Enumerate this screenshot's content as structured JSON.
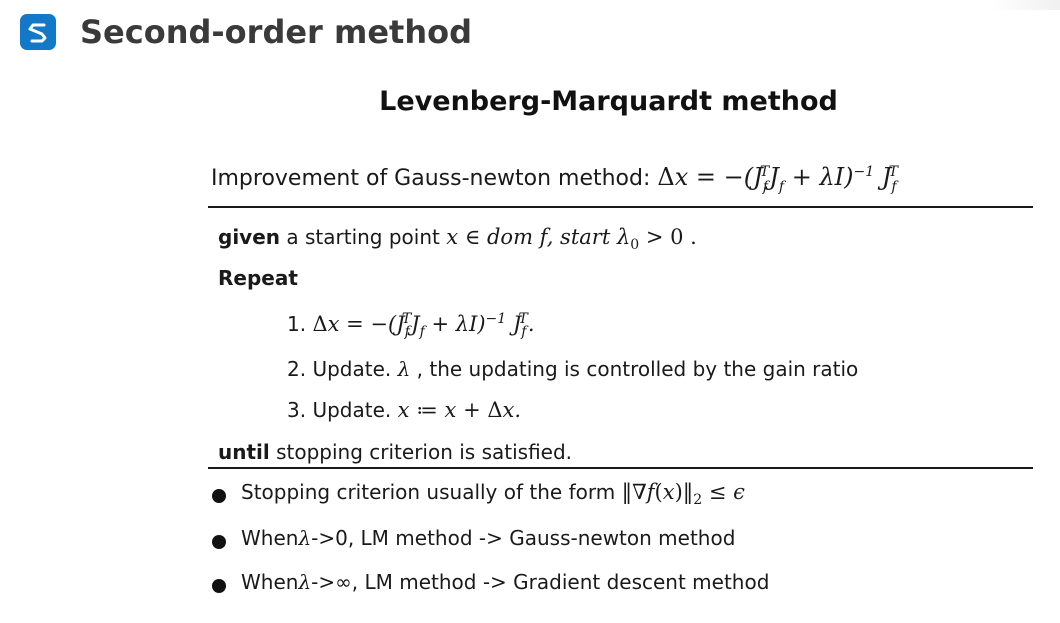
{
  "header": {
    "logo_icon": "stack-s-logo-icon",
    "accent_color": "#1478c8",
    "title": "Second-order method"
  },
  "slide": {
    "title": "Levenberg-Marquardt method",
    "improvement": {
      "label": "Improvement of Gauss-newton method: ",
      "formula": "Δx = −(J_f^T J_f + λI)^−1 J_f^T"
    },
    "algorithm": {
      "given_kw": "given",
      "given_text": " a starting point ",
      "given_math": "x ∈ dom f, start λ₀ > 0 .",
      "repeat_kw": "Repeat",
      "steps": [
        {
          "num": "1. ",
          "text": "",
          "math": "Δx = −(J_f^T J_f + λI)^−1 J_f^T."
        },
        {
          "num": "2. ",
          "text": "Update. ",
          "math": "λ",
          "tail": " , the updating is controlled by the gain ratio"
        },
        {
          "num": "3. ",
          "text": "Update. ",
          "math": "x ≔ x + Δx."
        }
      ],
      "until_kw": "until",
      "until_text": " stopping criterion is satisfied."
    },
    "bullets": [
      {
        "text": "Stopping criterion usually of the form ",
        "math": "‖∇f(x)‖₂ ≤ ϵ"
      },
      {
        "text_pre": "When",
        "math": "λ",
        "text_post": "->0, LM method -> Gauss-newton method"
      },
      {
        "text_pre": "When",
        "math": "λ",
        "text_post": "->∞, LM method -> Gradient descent method"
      }
    ]
  }
}
